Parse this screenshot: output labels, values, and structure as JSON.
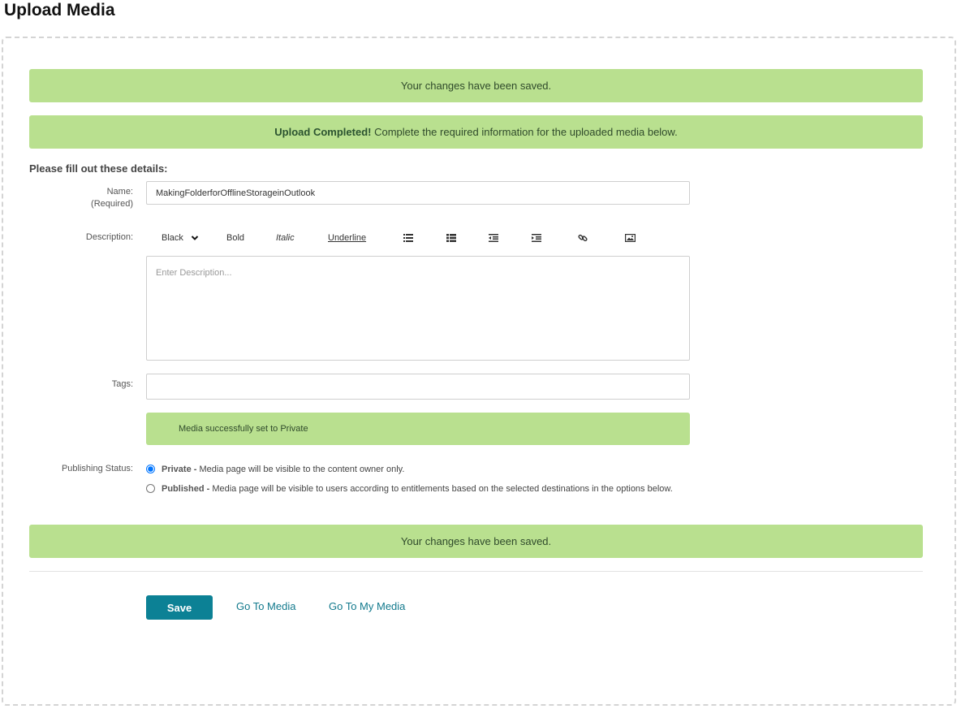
{
  "page": {
    "title": "Upload Media"
  },
  "alerts": {
    "saved_top": "Your changes have been saved.",
    "upload_completed_strong": "Upload Completed!",
    "upload_completed_text": " Complete the required information for the uploaded media below.",
    "saved_bottom": "Your changes have been saved.",
    "private_set": "Media successfully set to Private"
  },
  "form": {
    "heading": "Please fill out these details:",
    "name": {
      "label": "Name:",
      "required": "(Required)",
      "value": "MakingFolderforOfflineStorageinOutlook"
    },
    "description": {
      "label": "Description:",
      "placeholder": "Enter Description...",
      "toolbar": {
        "color": "Black",
        "bold": "Bold",
        "italic": "Italic",
        "underline": "Underline",
        "icons": [
          "bullet-list-icon",
          "numbered-list-icon",
          "outdent-icon",
          "indent-icon",
          "link-icon",
          "image-icon"
        ]
      }
    },
    "tags": {
      "label": "Tags:",
      "value": ""
    },
    "publishing": {
      "label": "Publishing Status:",
      "selected": "private",
      "private": {
        "title": "Private - ",
        "text": "Media page will be visible to the content owner only."
      },
      "published": {
        "title": "Published - ",
        "text": "Media page will be visible to users according to entitlements based on the selected destinations in the options below."
      }
    }
  },
  "actions": {
    "save": "Save",
    "go_to_media": "Go To Media",
    "go_to_my_media": "Go To My Media"
  },
  "colors": {
    "alert_green": "#b9e08f",
    "primary": "#0c8195",
    "link": "#137a8d"
  }
}
